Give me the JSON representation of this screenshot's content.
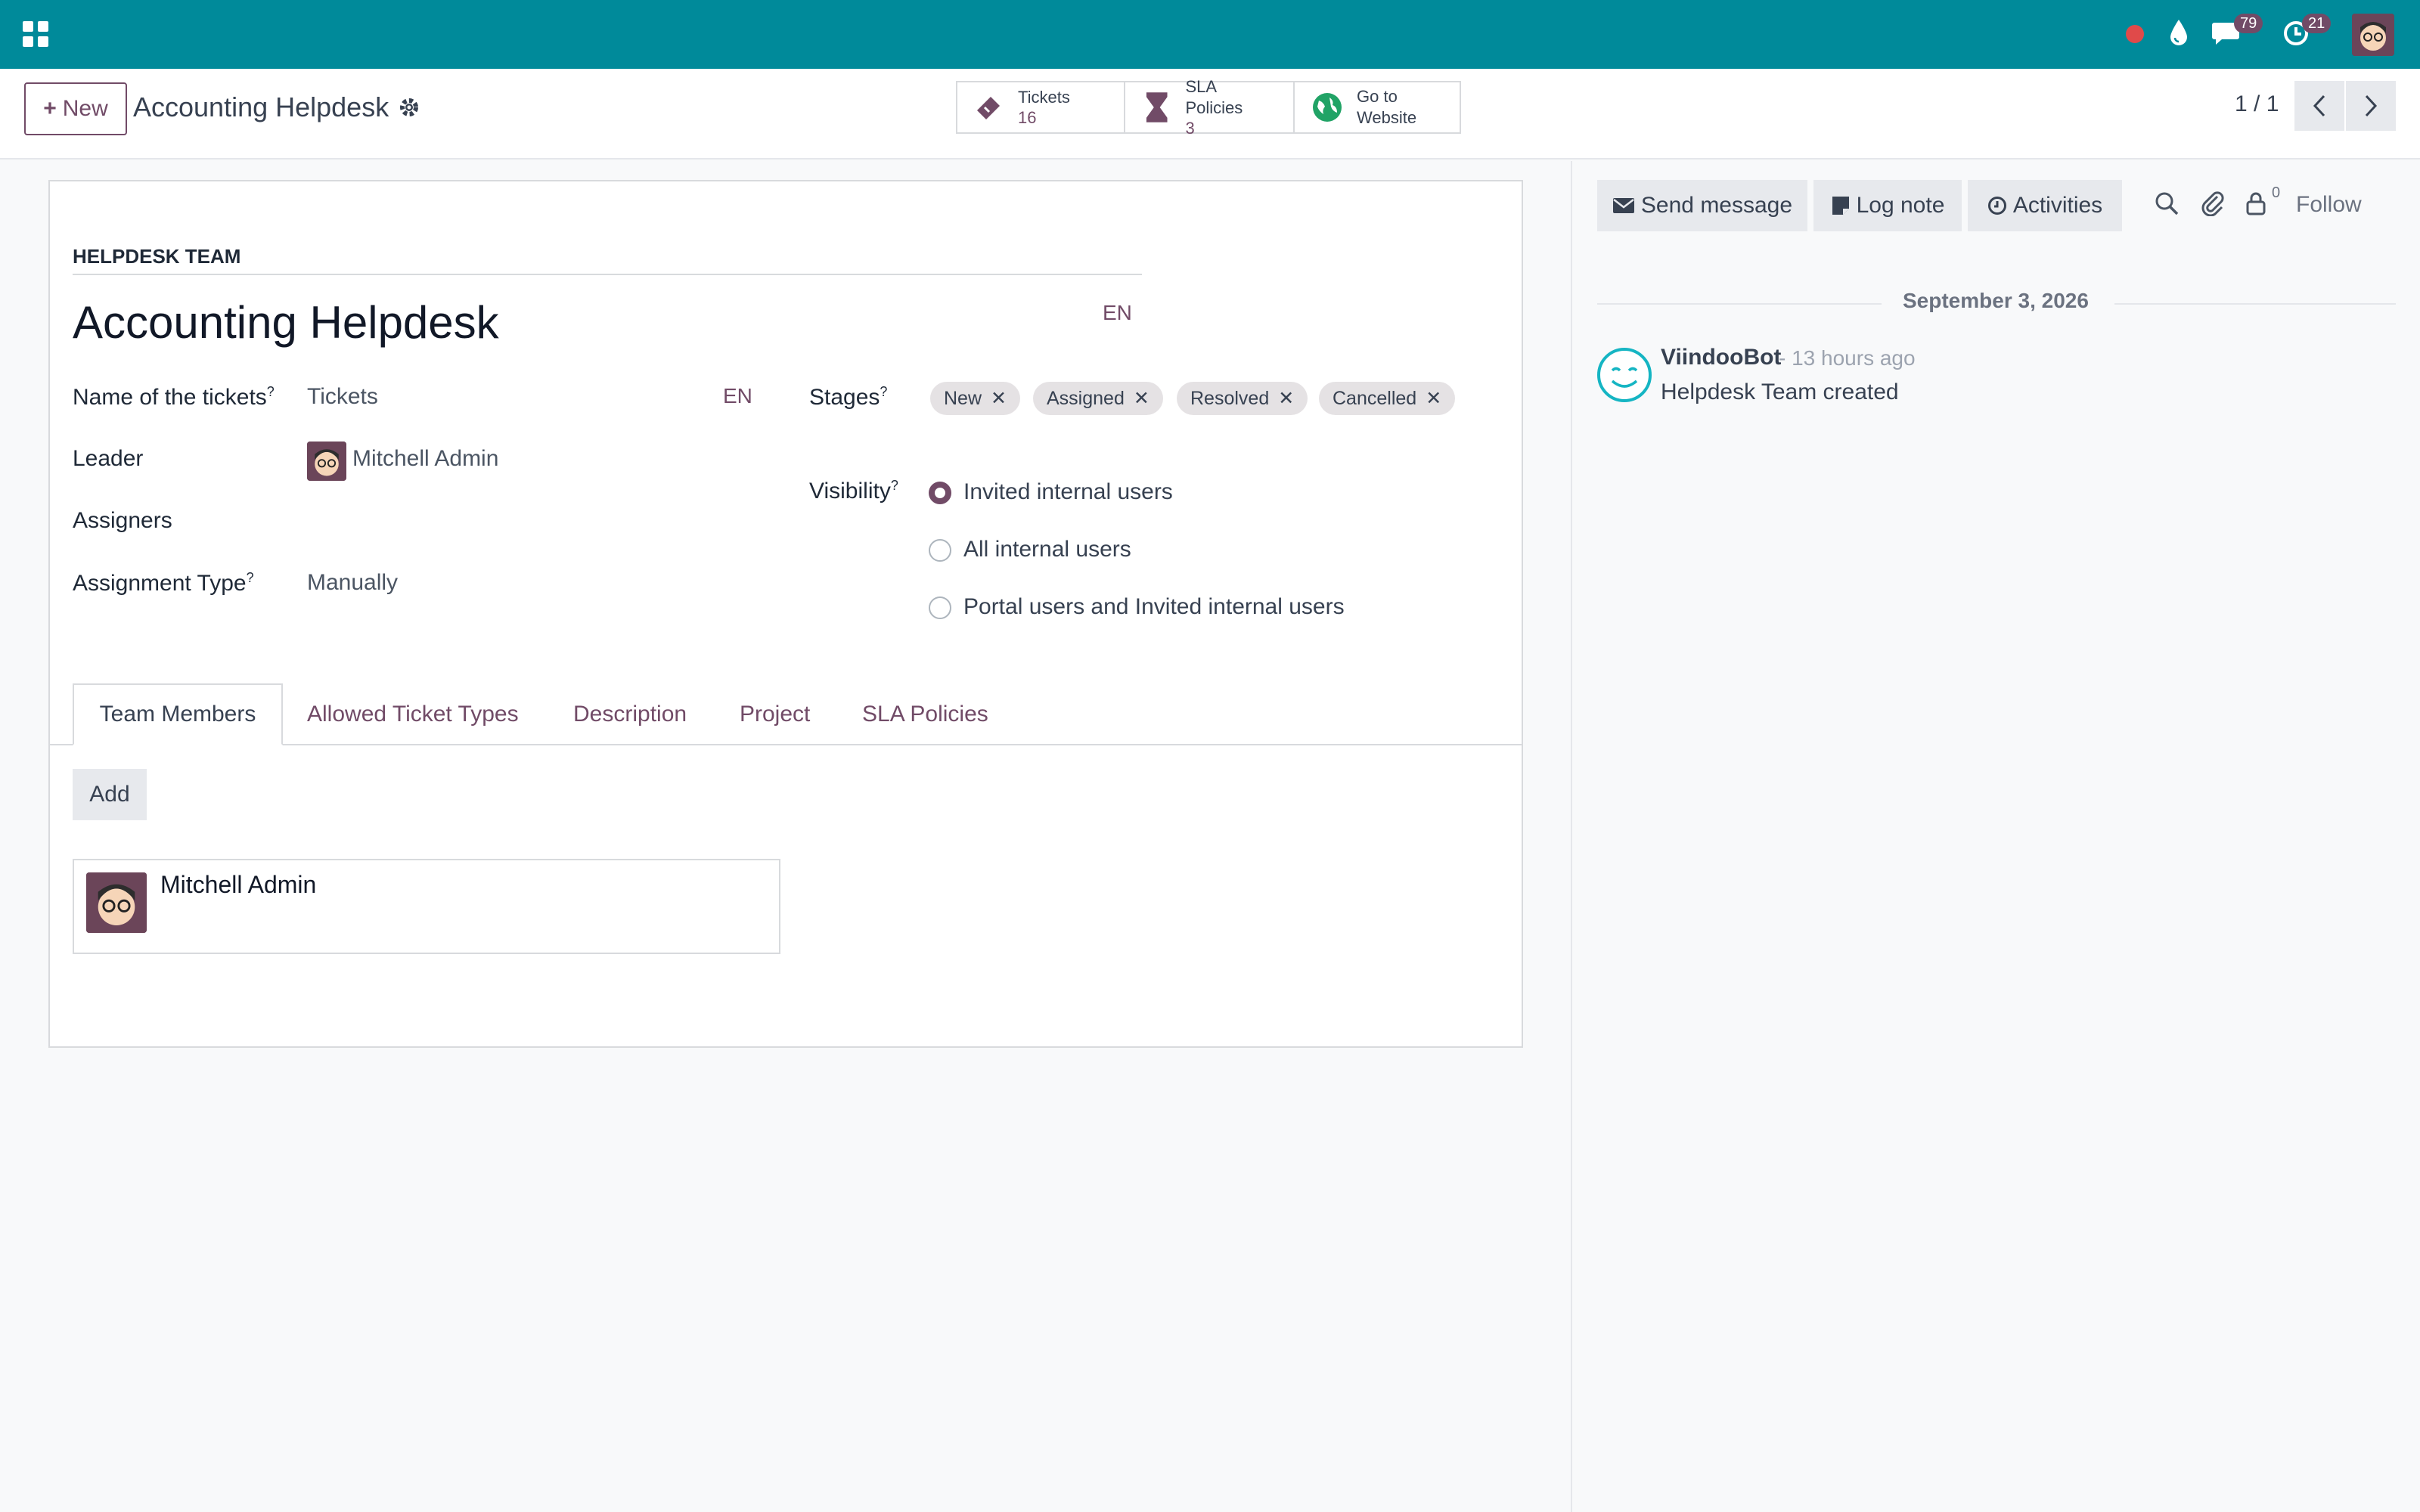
{
  "topbar": {
    "badge_chat": "79",
    "badge_activity": "21",
    "colors": {
      "bar": "#008a9a",
      "accent": "#714b67"
    }
  },
  "controlbar": {
    "new_label": "New",
    "breadcrumb": "Accounting Helpdesk",
    "smart_buttons": [
      {
        "label": "Tickets",
        "value": "16",
        "icon": "ticket-icon"
      },
      {
        "label": "SLA Policies",
        "value": "3",
        "icon": "hourglass-icon"
      },
      {
        "label": "Go to",
        "value": "Website",
        "icon": "globe-icon"
      }
    ],
    "pager": "1 / 1"
  },
  "form": {
    "section_label": "HELPDESK TEAM",
    "title": "Accounting Helpdesk",
    "lang": "EN",
    "fields": {
      "tickets_name_label": "Name of the tickets",
      "tickets_name_value": "Tickets",
      "tickets_name_lang": "EN",
      "leader_label": "Leader",
      "leader_value": "Mitchell Admin",
      "assigners_label": "Assigners",
      "assignment_type_label": "Assignment Type",
      "assignment_type_value": "Manually",
      "stages_label": "Stages",
      "visibility_label": "Visibility"
    },
    "stages": [
      "New",
      "Assigned",
      "Resolved",
      "Cancelled"
    ],
    "visibility_options": [
      {
        "label": "Invited internal users",
        "checked": true
      },
      {
        "label": "All internal users",
        "checked": false
      },
      {
        "label": "Portal users and Invited internal users",
        "checked": false
      }
    ],
    "tabs": [
      "Team Members",
      "Allowed Ticket Types",
      "Description",
      "Project",
      "SLA Policies"
    ],
    "add_label": "Add",
    "members": [
      "Mitchell Admin"
    ]
  },
  "chatter": {
    "send_message": "Send message",
    "log_note": "Log note",
    "activities": "Activities",
    "followers_count": "0",
    "follow": "Follow",
    "date": "September 3, 2026",
    "message": {
      "author": "ViindooBot",
      "time": "- 13 hours ago",
      "body": "Helpdesk Team created"
    }
  }
}
